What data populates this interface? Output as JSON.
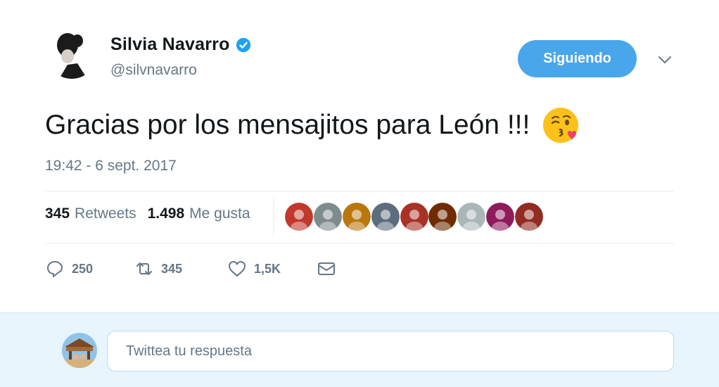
{
  "author": {
    "name": "Silvia Navarro",
    "handle": "@silvnavarro",
    "verified": true,
    "avatar_icon": "profile-photo"
  },
  "follow_button": {
    "label": "Siguiendo",
    "color": "#4aa6ea"
  },
  "menu": {
    "icon": "chevron-down-icon"
  },
  "tweet": {
    "text": "Gracias por los mensajitos para León !!!",
    "emoji_icon": "face-blowing-kiss-icon",
    "timestamp": "19:42 - 6 sept. 2017"
  },
  "stats": {
    "retweets_count": "345",
    "retweets_label": "Retweets",
    "likes_count": "1.498",
    "likes_label": "Me gusta"
  },
  "liked_by": [
    {
      "name": "liker-1",
      "color": "#c0392b"
    },
    {
      "name": "liker-2",
      "color": "#7f8c8d"
    },
    {
      "name": "liker-3",
      "color": "#b9770e"
    },
    {
      "name": "liker-4",
      "color": "#5d6d7e"
    },
    {
      "name": "liker-5",
      "color": "#a93226"
    },
    {
      "name": "liker-6",
      "color": "#6e2c00"
    },
    {
      "name": "liker-7",
      "color": "#aab7b8"
    },
    {
      "name": "liker-8",
      "color": "#8e1b5c"
    },
    {
      "name": "liker-9",
      "color": "#922b21"
    }
  ],
  "actions": {
    "reply": {
      "count": "250",
      "icon": "reply-icon"
    },
    "retweet": {
      "count": "345",
      "icon": "retweet-icon"
    },
    "like": {
      "count": "1,5K",
      "icon": "heart-icon"
    },
    "dm": {
      "icon": "envelope-icon"
    }
  },
  "reply_box": {
    "placeholder": "Twittea tu respuesta",
    "avatar_icon": "user-avatar"
  }
}
